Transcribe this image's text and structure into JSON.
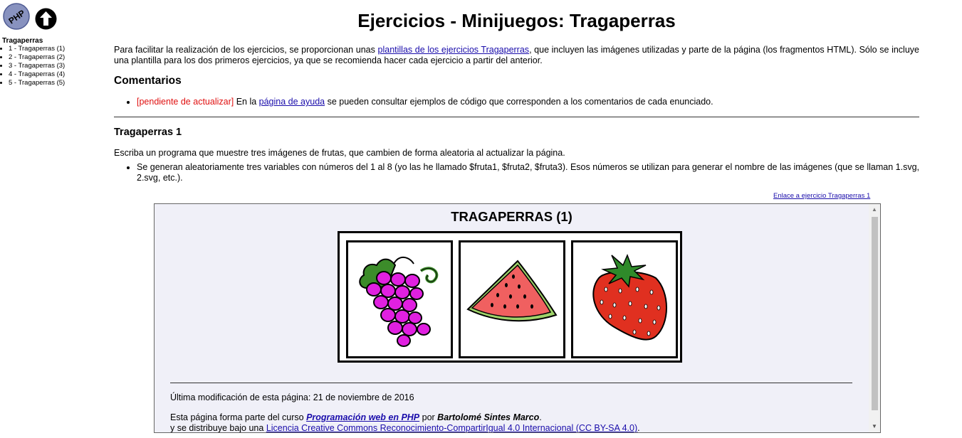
{
  "sidebar": {
    "logo_text": "PHP",
    "title": "Tragaperras",
    "items": [
      {
        "label": "1 - Tragaperras (1)"
      },
      {
        "label": "2 - Tragaperras (2)"
      },
      {
        "label": "3 - Tragaperras (3)"
      },
      {
        "label": "4 - Tragaperras (4)"
      },
      {
        "label": "5 - Tragaperras (5)"
      }
    ]
  },
  "page": {
    "title": "Ejercicios - Minijuegos: Tragaperras",
    "intro": {
      "before": "Para facilitar la realización de los ejercicios, se proporcionan unas ",
      "link": "plantillas de los ejercicios Tragaperras",
      "after": ", que incluyen las imágenes utilizadas y parte de la página (los fragmentos HTML). Sólo se incluye una plantilla para los dos primeros ejercicios, ya que se recomienda hacer cada ejercicio a partir del anterior."
    },
    "comments": {
      "heading": "Comentarios",
      "pending": "[pendiente de actualizar]",
      "before": " En la ",
      "link": "página de ayuda",
      "after": " se pueden consultar ejemplos de código que corresponden a los comentarios de cada enunciado."
    },
    "exercise1": {
      "heading": "Tragaperras 1",
      "description": "Escriba un programa que muestre tres imágenes de frutas, que cambien de forma aleatoria al actualizar la página.",
      "bullet": "Se generan aleatoriamente tres variables con números del 1 al 8 (yo las he llamado $fruta1, $fruta2, $fruta3). Esos números se utilizan para generar el nombre de las imágenes (que se llaman 1.svg, 2.svg, etc.).",
      "link": "Enlace a ejercicio Tragaperras 1"
    }
  },
  "frame": {
    "title": "TRAGAPERRAS (1)",
    "fruits": [
      "grapes",
      "watermelon",
      "strawberry"
    ],
    "last_modified": "Última modificación de esta página: 21 de noviembre de 2016",
    "course_line1_before": "Esta página forma parte del curso ",
    "course_link": "Programación web en PHP",
    "course_line1_mid": " por ",
    "course_author": "Bartolomé Sintes Marco",
    "course_line1_end": ".",
    "course_line2_before": "y se distribuye bajo una ",
    "course_license": "Licencia Creative Commons Reconocimiento-CompartirIgual 4.0 Internacional (CC BY-SA 4.0)",
    "course_line2_end": "."
  },
  "icons": {
    "logo": "php-logo-icon",
    "up": "arrow-up-circle-icon",
    "scroll_up": "scroll-up-arrow-icon",
    "scroll_down": "scroll-down-arrow-icon"
  },
  "colors": {
    "link": "#1a0dab",
    "pending": "#e01010",
    "frame_bg": "#f0f0f8",
    "grape": "#e020e0",
    "strawberry": "#e03020",
    "watermelon": "#f06060"
  }
}
